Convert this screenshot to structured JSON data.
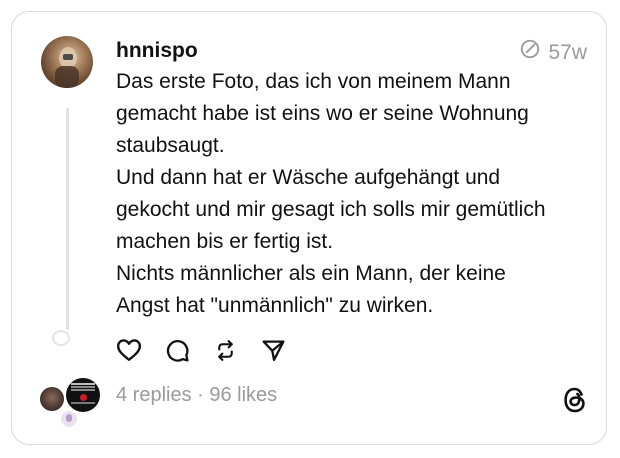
{
  "post": {
    "username": "hnnispo",
    "time": "57w",
    "lines": [
      "Das erste Foto, das ich von meinem Mann",
      "gemacht habe ist eins wo er seine Wohnung",
      "staubsaugt.",
      "Und dann hat er Wäsche aufgehängt und",
      "gekocht und mir gesagt ich solls mir gemütlich",
      "machen bis er fertig ist.",
      "Nichts männlicher als ein Mann, der keine",
      "Angst hat \"unmännlich\" zu wirken."
    ]
  },
  "stats": {
    "text": "4 replies · 96 likes"
  },
  "icons": {
    "time": "edited-clock-icon",
    "like": "heart-icon",
    "reply": "comment-icon",
    "repost": "repost-icon",
    "share": "send-icon",
    "brand": "threads-logo-icon"
  },
  "colors": {
    "text": "#111111",
    "muted": "#9a9a9a",
    "border": "#d9d9d9"
  }
}
